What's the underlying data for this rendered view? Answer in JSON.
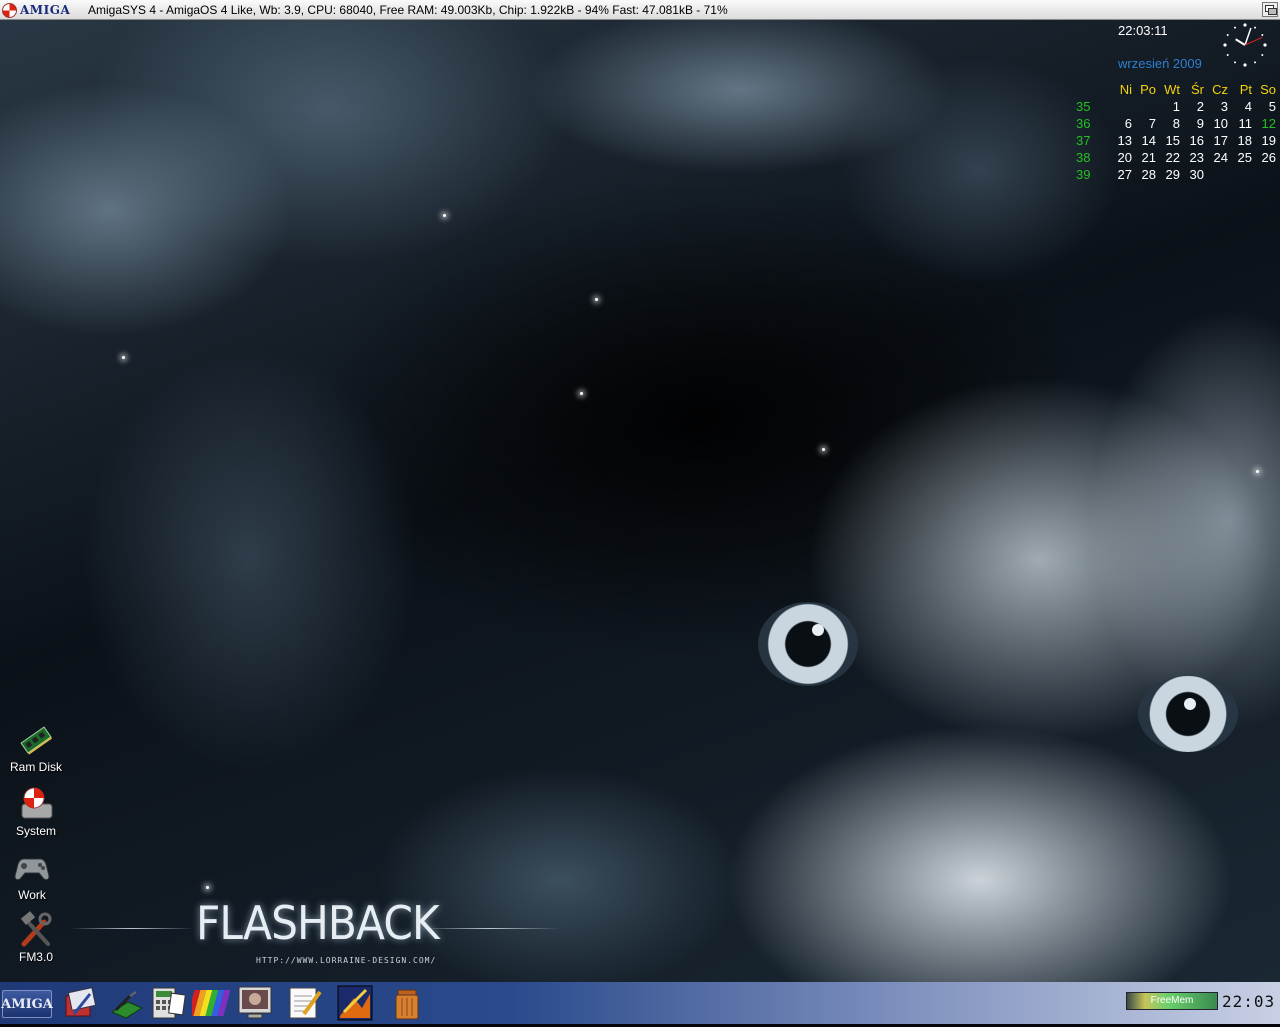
{
  "titlebar": {
    "logo_text": "AMIGA",
    "title": "AmigaSYS 4 - AmigaOS 4 Like, Wb: 3.9, CPU: 68040, Free RAM: 49.003Kb, Chip: 1.922kB - 94% Fast: 47.081kB - 71%",
    "depth_gadget_icon": "depth-arrange-icon"
  },
  "clock": {
    "digital": "22:03:11",
    "hour": 22,
    "minute": 3,
    "second": 11
  },
  "calendar": {
    "month_year": "wrzesień  2009",
    "headers": [
      "Ni",
      "Po",
      "Wt",
      "Śr",
      "Cz",
      "Pt",
      "So"
    ],
    "weeks": [
      {
        "num": "35",
        "days": [
          "",
          "",
          "1",
          "2",
          "3",
          "4",
          "5"
        ]
      },
      {
        "num": "36",
        "days": [
          "6",
          "7",
          "8",
          "9",
          "10",
          "11",
          "12"
        ]
      },
      {
        "num": "37",
        "days": [
          "13",
          "14",
          "15",
          "16",
          "17",
          "18",
          "19"
        ]
      },
      {
        "num": "38",
        "days": [
          "20",
          "21",
          "22",
          "23",
          "24",
          "25",
          "26"
        ]
      },
      {
        "num": "39",
        "days": [
          "27",
          "28",
          "29",
          "30",
          "",
          "",
          ""
        ]
      }
    ],
    "colors": {
      "header": "#f4d20c",
      "week_number": "#25c023",
      "today": "#25c023",
      "day": "#ffffff",
      "month": "#2f7fd0"
    }
  },
  "wallpaper": {
    "logo_text": "FLASHBACK",
    "url_text": "HTTP://WWW.LORRAINE-DESIGN.COM/"
  },
  "desktop_icons": [
    {
      "label": "Ram Disk",
      "icon": "ram-chip-icon"
    },
    {
      "label": "System",
      "icon": "boing-ball-drive-icon"
    },
    {
      "label": "Work",
      "icon": "gamepad-icon"
    },
    {
      "label": "FM3.0",
      "icon": "tools-icon"
    }
  ],
  "taskbar": {
    "start_label": "AMIGA",
    "dock": [
      {
        "icon": "toolkit-icon"
      },
      {
        "icon": "shell-icon"
      },
      {
        "icon": "calculator-icon"
      },
      {
        "icon": "color-palette-icon"
      },
      {
        "icon": "monitor-icon"
      },
      {
        "icon": "notepad-icon"
      },
      {
        "icon": "paint-icon"
      },
      {
        "icon": "trashcan-icon"
      }
    ],
    "freemem_label": "FreeMem",
    "time": "22:03"
  }
}
